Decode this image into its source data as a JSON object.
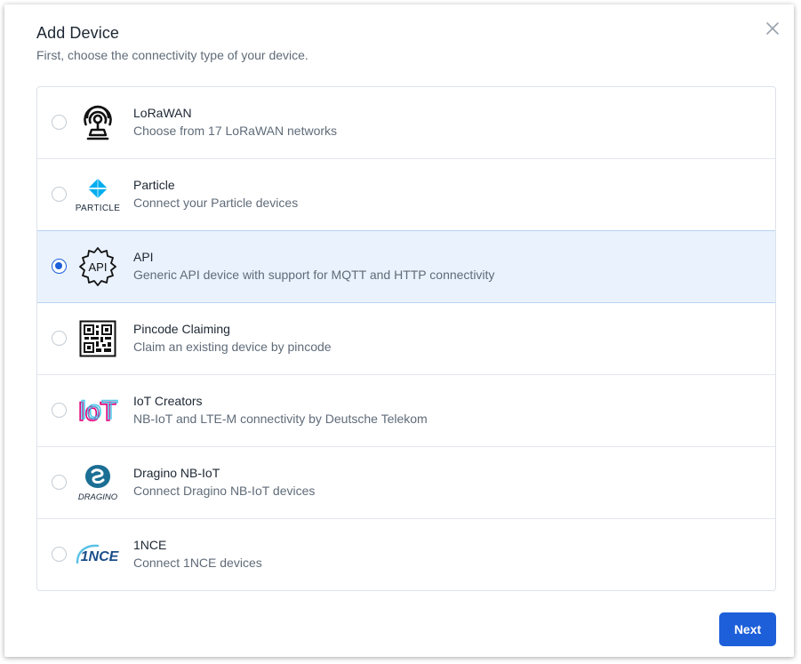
{
  "dialog": {
    "title": "Add Device",
    "subtitle": "First, choose the connectivity type of your device.",
    "next_label": "Next"
  },
  "options": [
    {
      "name": "LoRaWAN",
      "description": "Choose from 17 LoRaWAN networks",
      "icon": "antenna-icon",
      "selected": false
    },
    {
      "name": "Particle",
      "description": "Connect your Particle devices",
      "icon": "particle-logo-icon",
      "selected": false
    },
    {
      "name": "API",
      "description": "Generic API device with support for MQTT and HTTP connectivity",
      "icon": "api-gear-icon",
      "selected": true
    },
    {
      "name": "Pincode Claiming",
      "description": "Claim an existing device by pincode",
      "icon": "qr-code-icon",
      "selected": false
    },
    {
      "name": "IoT Creators",
      "description": "NB-IoT and LTE-M connectivity by Deutsche Telekom",
      "icon": "iot-creators-logo-icon",
      "selected": false
    },
    {
      "name": "Dragino NB-IoT",
      "description": "Connect Dragino NB-IoT devices",
      "icon": "dragino-logo-icon",
      "selected": false
    },
    {
      "name": "1NCE",
      "description": "Connect 1NCE devices",
      "icon": "1nce-logo-icon",
      "selected": false
    }
  ],
  "colors": {
    "accent": "#1d5fd9",
    "selected_bg": "#e9f2fd",
    "particle": "#00aeef"
  },
  "logos": {
    "particle": "PARTICLE",
    "iot": "IoT",
    "dragino": "DRAGINO",
    "onence": "1NCE"
  }
}
